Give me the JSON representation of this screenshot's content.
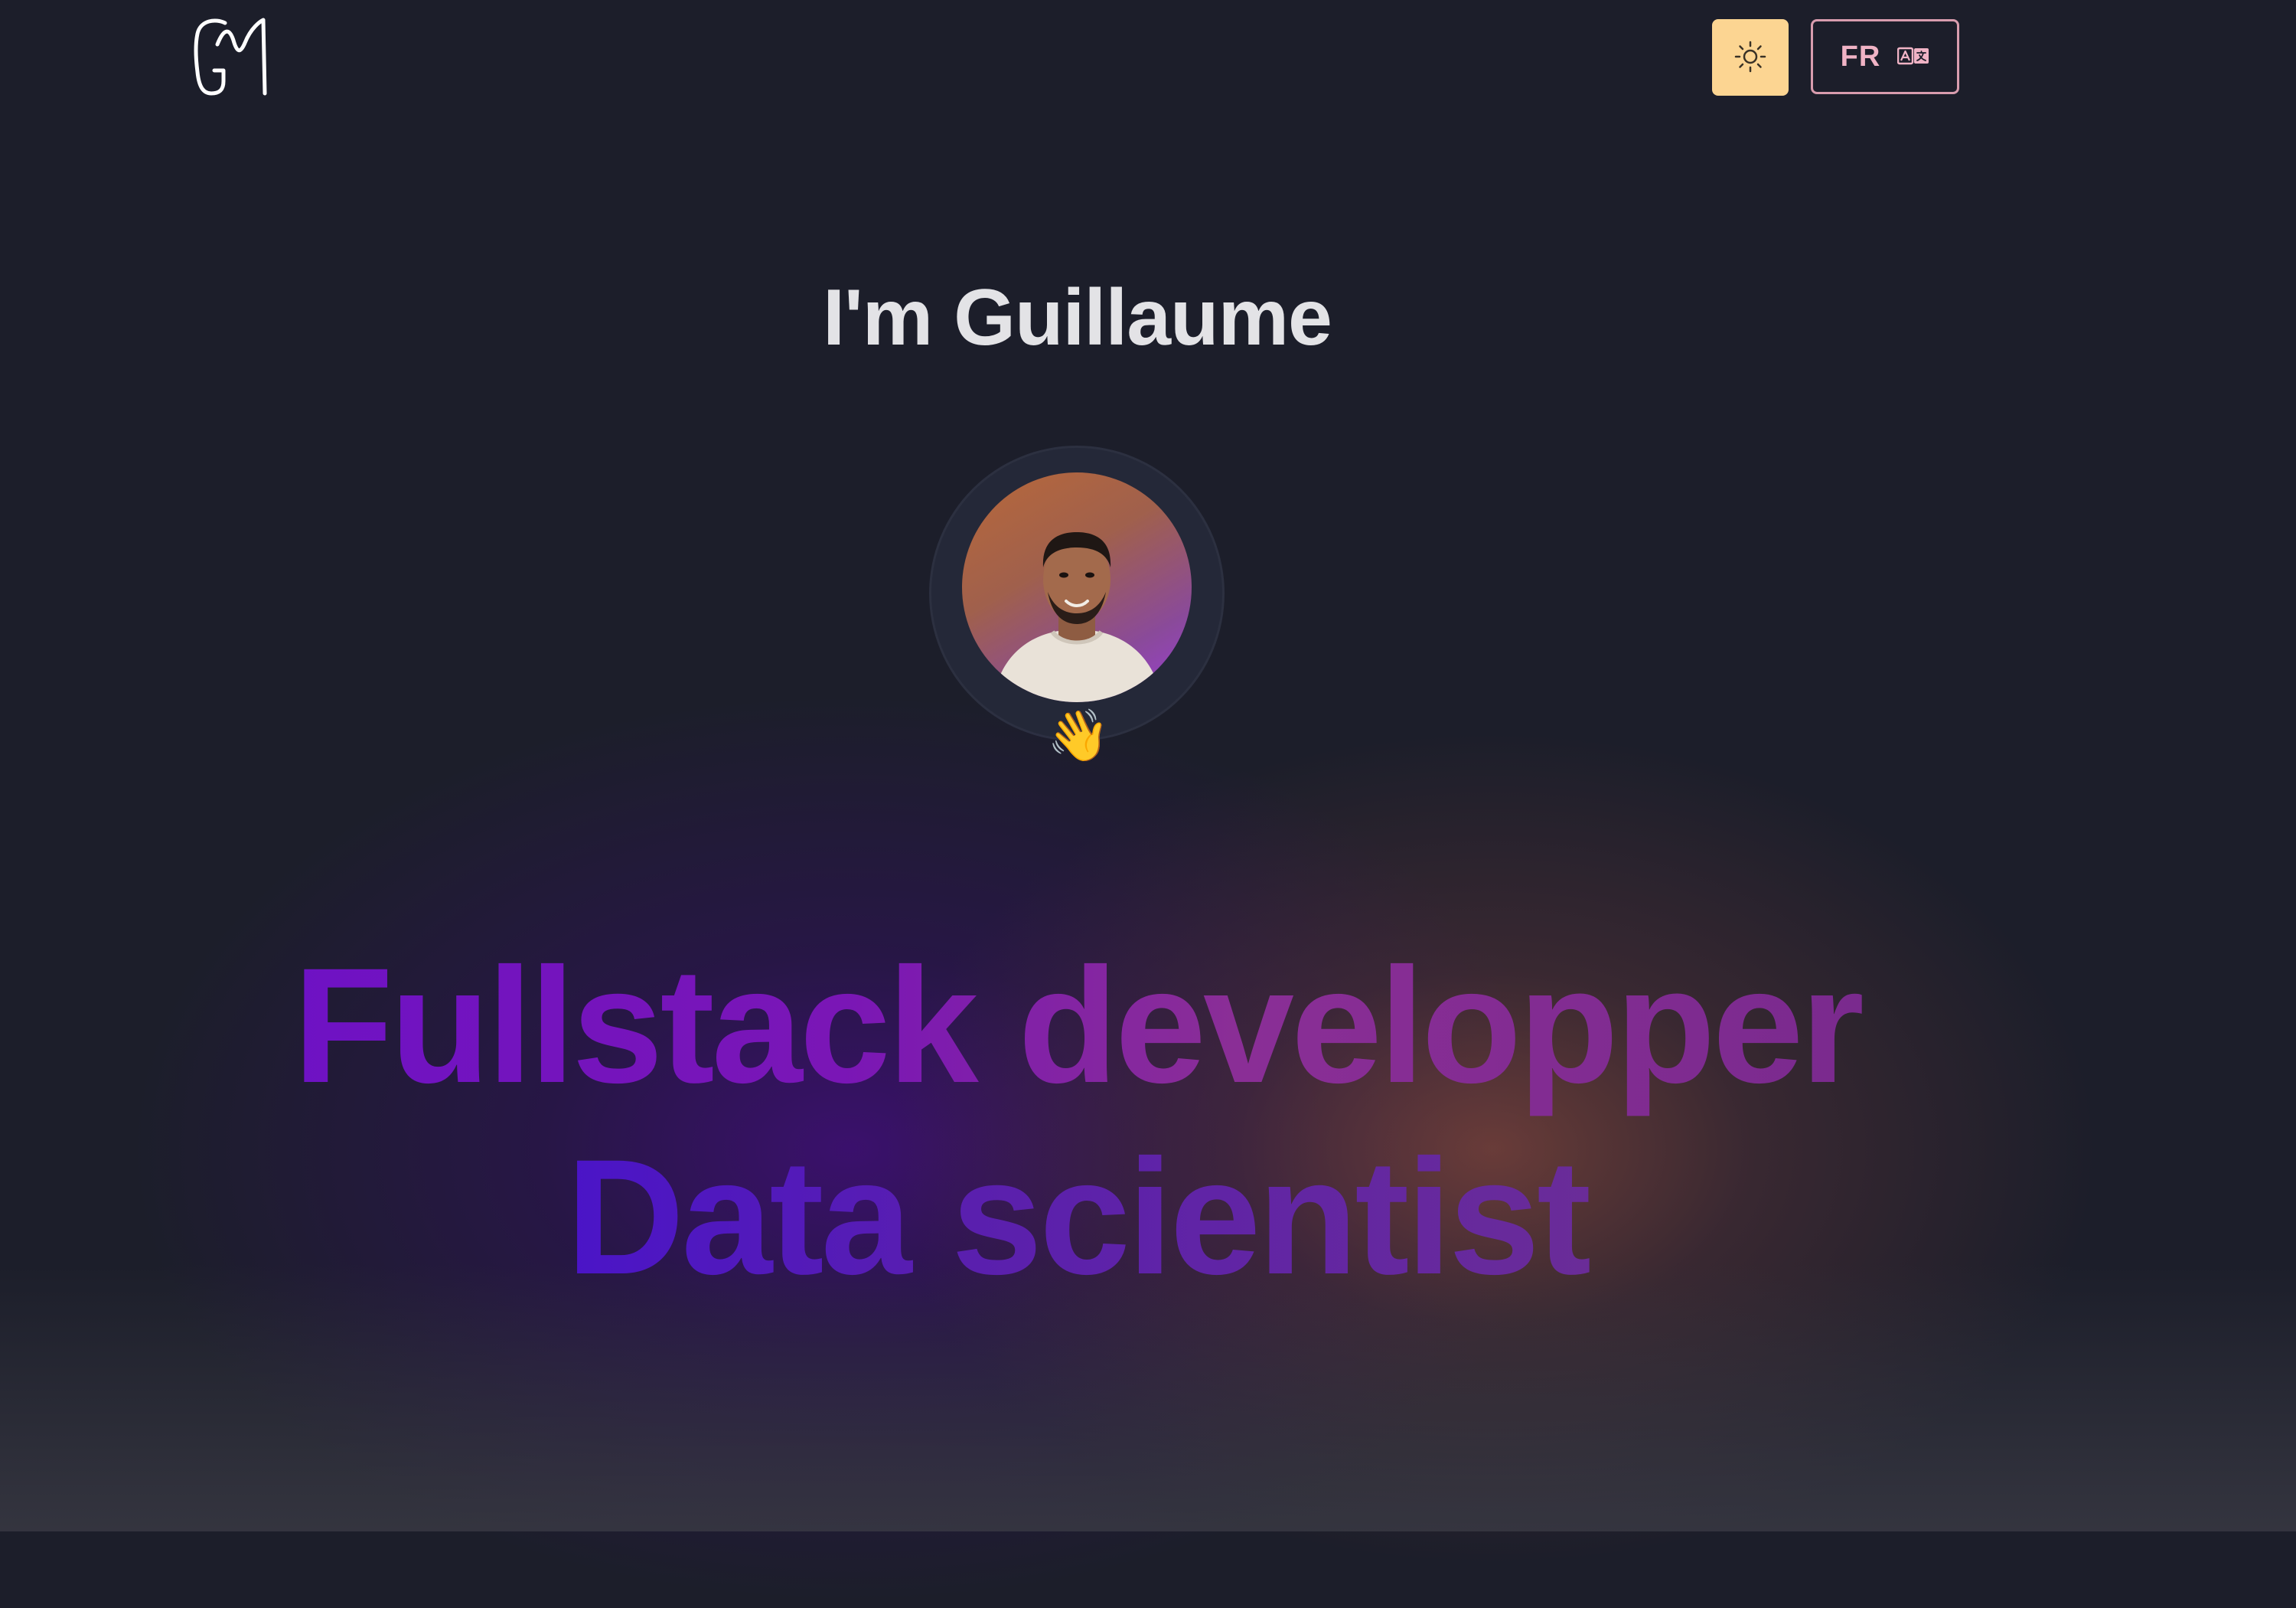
{
  "header": {
    "logo_icon": "gm-monogram-logo",
    "theme_toggle_icon": "sun-icon",
    "language_button_label": "FR",
    "language_icon": "translate-icon"
  },
  "hero": {
    "greeting": "I'm Guillaume",
    "avatar_icon": "profile-photo",
    "wave_emoji": "👋",
    "tagline_line1": "Fullstack developper",
    "tagline_line2": "Data scientist"
  },
  "colors": {
    "background": "#1c1e2a",
    "theme_button": "#fcd592",
    "language_button_border": "#d89cae",
    "language_label": "#f0b3c5",
    "greeting_text": "#e3e3e6",
    "tagline_purple": "#6e12c4",
    "tagline_violet": "#4a14c8"
  }
}
